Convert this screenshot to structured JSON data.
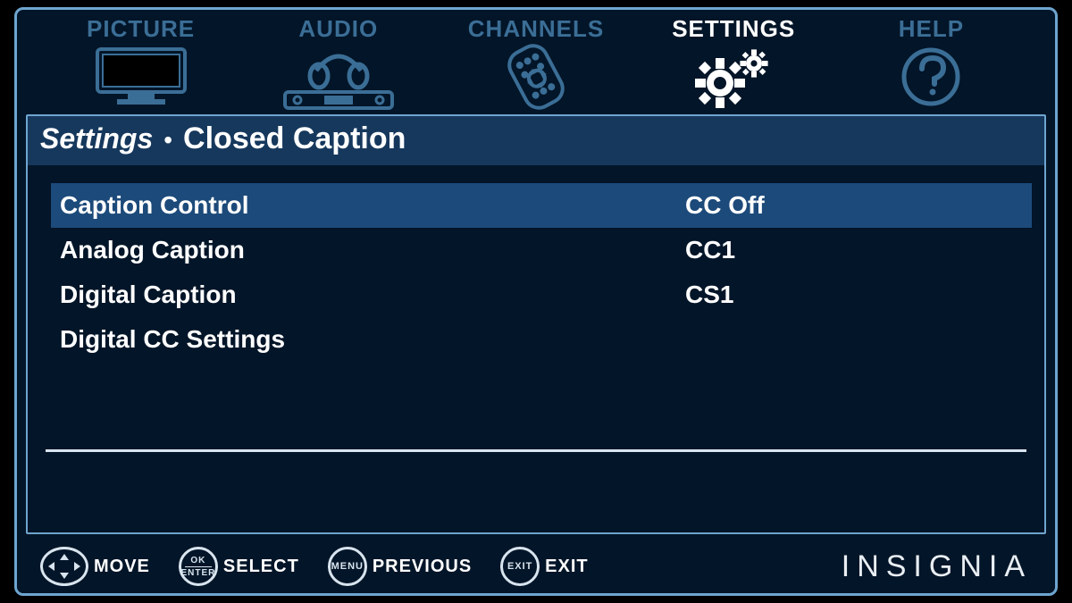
{
  "tabs": [
    {
      "label": "PICTURE",
      "icon": "tv-icon",
      "active": false
    },
    {
      "label": "AUDIO",
      "icon": "headphones-icon",
      "active": false
    },
    {
      "label": "CHANNELS",
      "icon": "remote-icon",
      "active": false
    },
    {
      "label": "SETTINGS",
      "icon": "gears-icon",
      "active": true
    },
    {
      "label": "HELP",
      "icon": "question-icon",
      "active": false
    }
  ],
  "breadcrumb": {
    "parent": "Settings",
    "current": "Closed Caption"
  },
  "rows": [
    {
      "label": "Caption Control",
      "value": "CC Off",
      "highlighted": true
    },
    {
      "label": "Analog Caption",
      "value": "CC1",
      "highlighted": false
    },
    {
      "label": "Digital Caption",
      "value": "CS1",
      "highlighted": false
    },
    {
      "label": "Digital CC Settings",
      "value": "",
      "highlighted": false
    }
  ],
  "hints": {
    "move": "MOVE",
    "select": "SELECT",
    "previous": "PREVIOUS",
    "exit": "EXIT",
    "ok_label": "OK",
    "enter_label": "ENTER",
    "menu_label": "MENU",
    "exit_label": "EXIT"
  },
  "brand": "INSIGNIA"
}
